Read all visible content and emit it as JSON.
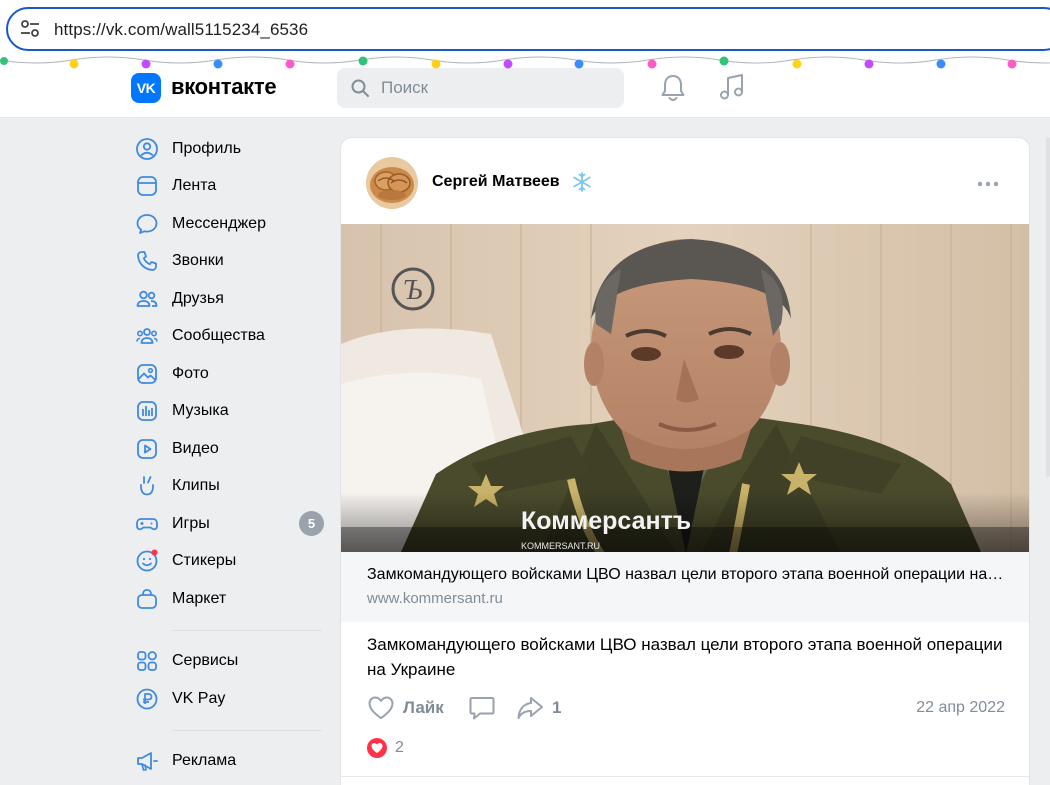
{
  "browser": {
    "url": "https://vk.com/wall5115234_6536"
  },
  "header": {
    "logo_text": "VK",
    "brand": "вконтакте",
    "search_placeholder": "Поиск"
  },
  "sidebar": {
    "items": [
      {
        "label": "Профиль",
        "icon": "profile-icon"
      },
      {
        "label": "Лента",
        "icon": "feed-icon"
      },
      {
        "label": "Мессенджер",
        "icon": "messenger-icon"
      },
      {
        "label": "Звонки",
        "icon": "phone-icon"
      },
      {
        "label": "Друзья",
        "icon": "friends-icon"
      },
      {
        "label": "Сообщества",
        "icon": "communities-icon"
      },
      {
        "label": "Фото",
        "icon": "photo-icon"
      },
      {
        "label": "Музыка",
        "icon": "music-icon"
      },
      {
        "label": "Видео",
        "icon": "video-icon"
      },
      {
        "label": "Клипы",
        "icon": "clips-icon"
      },
      {
        "label": "Игры",
        "icon": "games-icon",
        "badge": "5"
      },
      {
        "label": "Стикеры",
        "icon": "stickers-icon"
      },
      {
        "label": "Маркет",
        "icon": "market-icon"
      }
    ],
    "items2": [
      {
        "label": "Сервисы",
        "icon": "services-icon"
      },
      {
        "label": "VK Pay",
        "icon": "vkpay-icon"
      }
    ],
    "items3": [
      {
        "label": "Реклама",
        "icon": "ads-icon"
      }
    ]
  },
  "post": {
    "author": "Сергей Матвеев",
    "image_watermark": "Коммерсантъ",
    "image_watermark_url": "KOMMERSANT.RU",
    "link_title": "Замкомандующего войсками ЦВО назвал цели второго этапа военной операции на Украине",
    "link_domain": "www.kommersant.ru",
    "text": "Замкомандующего войсками ЦВО назвал цели второго этапа военной операции на Украине",
    "like_label": "Лайк",
    "share_count": "1",
    "date": "22 апр 2022",
    "reactions_count": "2"
  },
  "colors": {
    "accent": "#0077ff",
    "url_border": "#1a57c8",
    "reaction": "#ff3347",
    "secondary_text": "#818c99"
  }
}
